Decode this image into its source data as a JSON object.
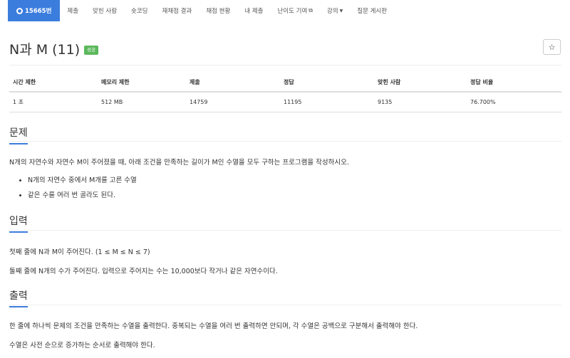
{
  "nav": {
    "problem_id": "15665번",
    "items": [
      "제출",
      "맞힌 사람",
      "숏코딩",
      "재채점 결과",
      "채점 현황",
      "내 제출",
      "난이도 기여",
      "강의",
      "질문 게시판"
    ]
  },
  "title": "N과 M (11)",
  "status_badge": "성공",
  "star_icon": "☆",
  "stats": {
    "headers": [
      "시간 제한",
      "메모리 제한",
      "제출",
      "정답",
      "맞힌 사람",
      "정답 비율"
    ],
    "values": [
      "1 초",
      "512 MB",
      "14759",
      "11195",
      "9135",
      "76.700%"
    ]
  },
  "sections": {
    "problem": {
      "heading": "문제",
      "text": "N개의 자연수와 자연수 M이 주어졌을 때, 아래 조건을 만족하는 길이가 M인 수열을 모두 구하는 프로그램을 작성하시오.",
      "bullets": [
        "N개의 자연수 중에서 M개를 고른 수열",
        "같은 수를 여러 번 골라도 된다."
      ]
    },
    "input": {
      "heading": "입력",
      "lines": [
        "첫째 줄에 N과 M이 주어진다. (1 ≤ M ≤ N ≤ 7)",
        "둘째 줄에 N개의 수가 주어진다. 입력으로 주어지는 수는 10,000보다 작거나 같은 자연수이다."
      ]
    },
    "output": {
      "heading": "출력",
      "lines": [
        "한 줄에 하나씩 문제의 조건을 만족하는 수열을 출력한다. 중복되는 수열을 여러 번 출력하면 안되며, 각 수열은 공백으로 구분해서 출력해야 한다.",
        "수열은 사전 순으로 증가하는 순서로 출력해야 한다."
      ]
    }
  },
  "colors": {
    "accent": "#3b7ddd",
    "success": "#5cb85c"
  }
}
